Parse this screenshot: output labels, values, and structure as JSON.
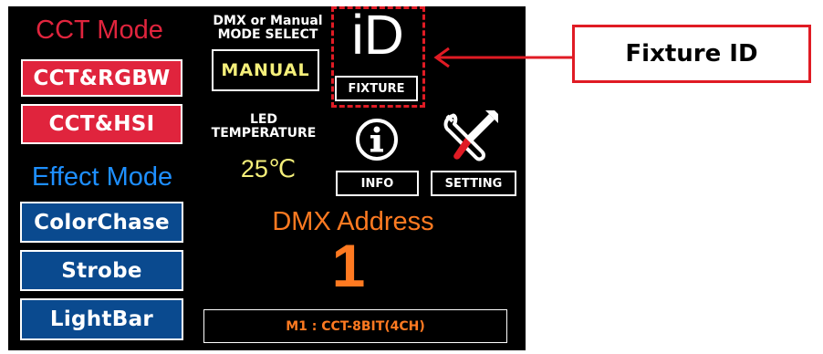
{
  "left_panel": {
    "cct_mode_title": "CCT Mode",
    "cct_buttons": [
      "CCT&RGBW",
      "CCT&HSI"
    ],
    "effect_mode_title": "Effect Mode",
    "effect_buttons": [
      "ColorChase",
      "Strobe",
      "LightBar"
    ]
  },
  "mode_select": {
    "title_line1": "DMX or Manual",
    "title_line2": "MODE SELECT",
    "value": "MANUAL"
  },
  "led_temperature": {
    "label_line1": "LED",
    "label_line2": "TEMPERATURE",
    "value": "25℃"
  },
  "fixture": {
    "icon_text": "iD",
    "label": "FIXTURE"
  },
  "info": {
    "label": "INFO"
  },
  "setting": {
    "label": "SETTING"
  },
  "dmx": {
    "title": "DMX Address",
    "value": "1"
  },
  "mode_status": "M1 : CCT-8BIT(4CH)",
  "callout": {
    "label": "Fixture ID"
  },
  "colors": {
    "cct_title": "#e0243d",
    "effect_title": "#1e8fff",
    "dmx_orange": "#ff7a21",
    "manual_yellow": "#f4ef7a",
    "temp_yellow": "#f4ef7a",
    "annotation_red": "#e01b24"
  },
  "icons": [
    "info-icon",
    "setting-tools-icon",
    "arrow-left-icon"
  ]
}
